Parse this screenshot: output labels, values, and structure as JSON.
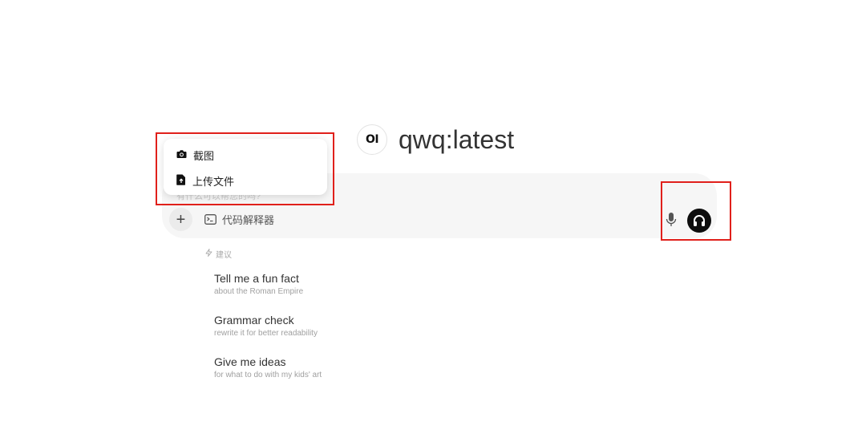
{
  "header": {
    "logo_text": "OI",
    "model_name": "qwq:latest"
  },
  "chat": {
    "placeholder_fragment": "有什么可以帮您的吗?",
    "add_label": "+",
    "code_interpreter_label": "代码解释器"
  },
  "menu": {
    "items": [
      {
        "label": "截图",
        "icon": "camera-icon"
      },
      {
        "label": "上传文件",
        "icon": "file-upload-icon"
      }
    ]
  },
  "suggestions": {
    "header": "建议",
    "items": [
      {
        "title": "Tell me a fun fact",
        "subtitle": "about the Roman Empire"
      },
      {
        "title": "Grammar check",
        "subtitle": "rewrite it for better readability"
      },
      {
        "title": "Give me ideas",
        "subtitle": "for what to do with my kids' art"
      }
    ]
  },
  "colors": {
    "highlight": "#e0201b",
    "input_bg": "#f6f6f6",
    "voice_button": "#0d0d0d"
  }
}
